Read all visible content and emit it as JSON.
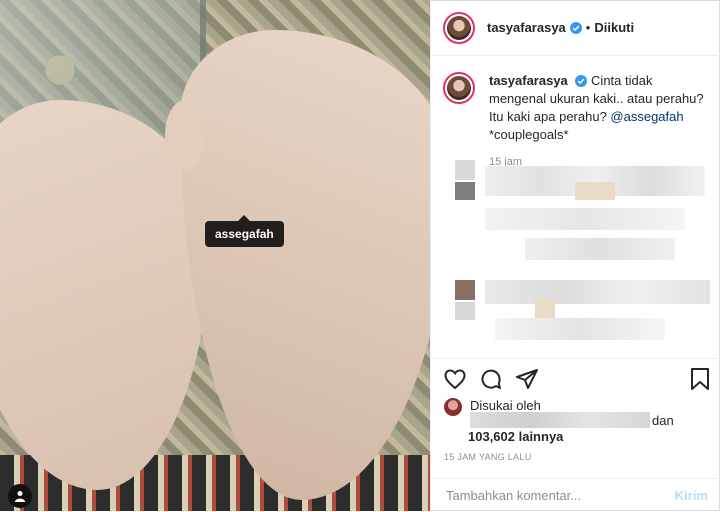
{
  "photo": {
    "tag_label": "assegafah"
  },
  "header": {
    "username": "tasyafarasya",
    "separator": "•",
    "follow_status": "Diikuti"
  },
  "caption": {
    "username": "tasyafarasya",
    "text_before": "Cinta tidak mengenal ukuran kaki.. atau perahu? Itu kaki apa perahu? ",
    "mention": "@assegafah",
    "text_after": " *couplegoals*",
    "time": "15 jam"
  },
  "likes": {
    "prefix": "Disukai oleh",
    "suffix": "dan",
    "count_text": "103,602 lainnya"
  },
  "timestamp": "15 JAM YANG LALU",
  "comment": {
    "placeholder": "Tambahkan komentar...",
    "send_label": "Kirim"
  },
  "icons": {
    "heart": "heart-icon",
    "comment": "comment-icon",
    "share": "paper-plane-icon",
    "save": "bookmark-icon",
    "verified": "verified-badge-icon",
    "user": "user-icon"
  },
  "colors": {
    "verified": "#3897f0",
    "link": "#00376b",
    "send_disabled": "#b2dffc",
    "muted": "#8e8e8e"
  }
}
